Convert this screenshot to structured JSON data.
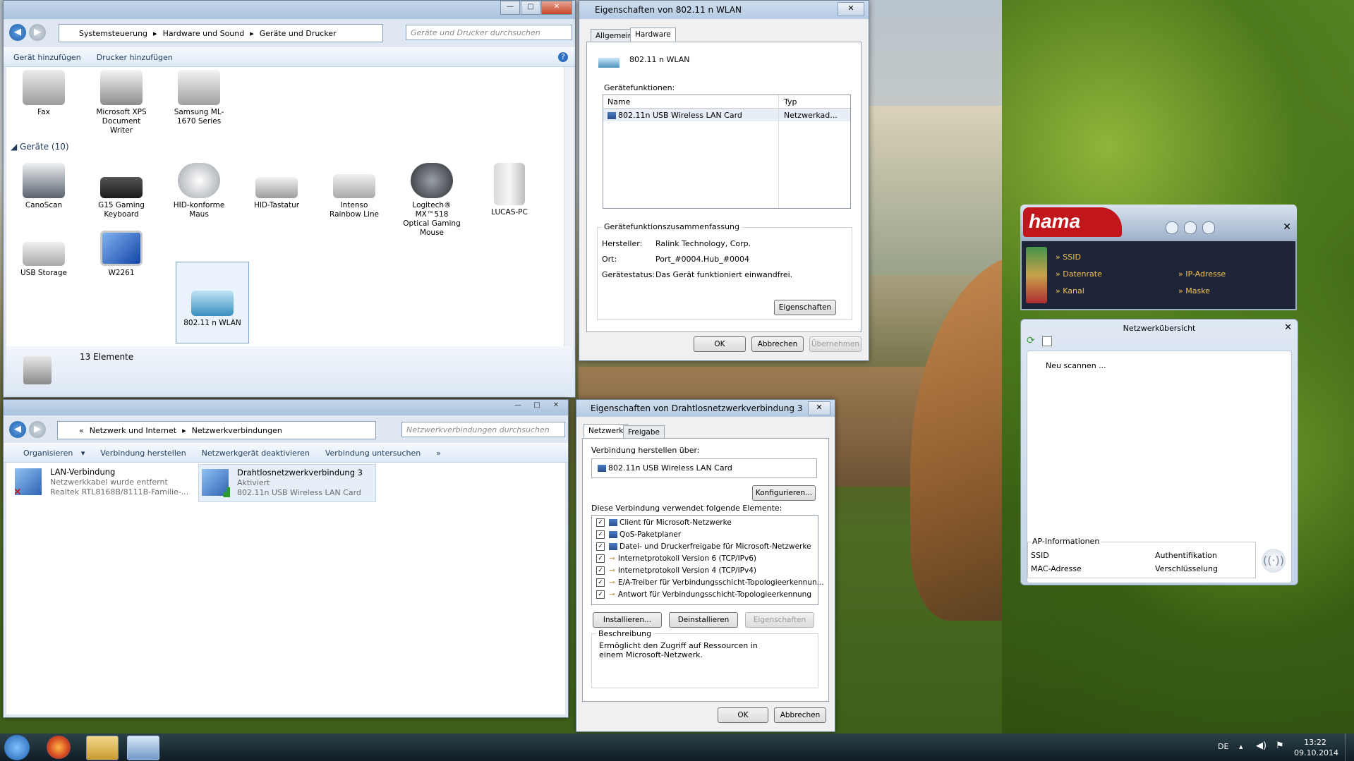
{
  "explorer1": {
    "breadcrumb": [
      "Systemsteuerung",
      "Hardware und Sound",
      "Geräte und Drucker"
    ],
    "search_placeholder": "Geräte und Drucker durchsuchen",
    "commands": [
      "Gerät hinzufügen",
      "Drucker hinzufügen"
    ],
    "printers": [
      {
        "label": "Fax"
      },
      {
        "label": "Microsoft XPS Document Writer"
      },
      {
        "label": "Samsung ML-1670 Series"
      }
    ],
    "group_label": "Geräte (10)",
    "devices": [
      {
        "label": "CanoScan"
      },
      {
        "label": "G15 Gaming Keyboard"
      },
      {
        "label": "HID-konforme Maus"
      },
      {
        "label": "HID-Tastatur"
      },
      {
        "label": "Intenso Rainbow Line"
      },
      {
        "label": "Logitech® MX™518 Optical Gaming Mouse"
      },
      {
        "label": "LUCAS-PC"
      },
      {
        "label": "USB Storage"
      },
      {
        "label": "W2261"
      },
      {
        "label": "802.11 n WLAN"
      }
    ],
    "count_text": "13 Elemente"
  },
  "explorer2": {
    "breadcrumb": [
      "Netzwerk und Internet",
      "Netzwerkverbindungen"
    ],
    "search_placeholder": "Netzwerkverbindungen durchsuchen",
    "commands": [
      "Organisieren",
      "Verbindung herstellen",
      "Netzwerkgerät deaktivieren",
      "Verbindung untersuchen"
    ],
    "connections": [
      {
        "name": "LAN-Verbindung",
        "status": "Netzwerkkabel wurde entfernt",
        "adapter": "Realtek RTL8168B/8111B-Familie-..."
      },
      {
        "name": "Drahtlosnetzwerkverbindung 3",
        "status": "Aktiviert",
        "adapter": "802.11n USB Wireless LAN Card"
      }
    ]
  },
  "dialog1": {
    "title": "Eigenschaften von 802.11 n WLAN",
    "tabs": [
      "Allgemein",
      "Hardware"
    ],
    "device_name": "802.11 n WLAN",
    "functions_label": "Gerätefunktionen:",
    "col_name": "Name",
    "col_type": "Typ",
    "row_name": "802.11n USB Wireless LAN Card",
    "row_type": "Netzwerkad...",
    "summary_label": "Gerätefunktionszusammenfassung",
    "manufacturer_label": "Hersteller:",
    "manufacturer": "Ralink Technology, Corp.",
    "location_label": "Ort:",
    "location": "Port_#0004.Hub_#0004",
    "status_label": "Gerätestatus:",
    "status": "Das Gerät funktioniert einwandfrei.",
    "properties_btn": "Eigenschaften",
    "ok": "OK",
    "cancel": "Abbrechen",
    "apply": "Übernehmen"
  },
  "dialog2": {
    "title": "Eigenschaften von Drahtlosnetzwerkverbindung 3",
    "tabs": [
      "Netzwerk",
      "Freigabe"
    ],
    "connect_label": "Verbindung herstellen über:",
    "adapter": "802.11n USB Wireless LAN Card",
    "configure_btn": "Konfigurieren...",
    "items_label": "Diese Verbindung verwendet folgende Elemente:",
    "items": [
      "Client für Microsoft-Netzwerke",
      "QoS-Paketplaner",
      "Datei- und Druckerfreigabe für Microsoft-Netzwerke",
      "Internetprotokoll Version 6 (TCP/IPv6)",
      "Internetprotokoll Version 4 (TCP/IPv4)",
      "E/A-Treiber für Verbindungsschicht-Topologieerkennun...",
      "Antwort für Verbindungsschicht-Topologieerkennung"
    ],
    "install_btn": "Installieren...",
    "uninstall_btn": "Deinstallieren",
    "properties_btn": "Eigenschaften",
    "desc_label": "Beschreibung",
    "desc_text": "Ermöglicht den Zugriff auf Ressourcen in einem Microsoft-Netzwerk.",
    "ok": "OK",
    "cancel": "Abbrechen"
  },
  "hama": {
    "logo": "hama",
    "ssid": "SSID",
    "datarate": "Datenrate",
    "channel": "Kanal",
    "ip": "IP-Adresse",
    "mask": "Maske",
    "overview_title": "Netzwerkübersicht",
    "rescan": "Neu scannen ...",
    "ap_label": "AP-Informationen",
    "ap_ssid": "SSID",
    "ap_auth": "Authentifikation",
    "ap_mac": "MAC-Adresse",
    "ap_enc": "Verschlüsselung"
  },
  "taskbar": {
    "lang": "DE",
    "time": "13:22",
    "date": "09.10.2014"
  }
}
